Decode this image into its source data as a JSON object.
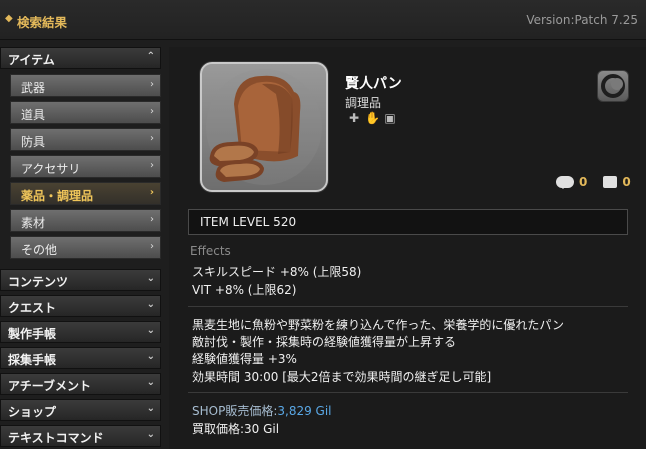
{
  "header": {
    "title": "検索結果",
    "version": "Version:Patch 7.25"
  },
  "sidebar": {
    "cat_item": "アイテム",
    "subs": [
      "武器",
      "道具",
      "防具",
      "アクセサリ",
      "薬品・調理品",
      "素材",
      "その他"
    ],
    "cats": [
      "コンテンツ",
      "クエスト",
      "製作手帳",
      "採集手帳",
      "アチーブメント",
      "ショップ",
      "テキストコマンド"
    ]
  },
  "item": {
    "name": "賢人パン",
    "type": "調理品",
    "comment_count": "0",
    "lodestone_count": "0",
    "item_level": "ITEM LEVEL 520"
  },
  "effects": {
    "label": "Effects",
    "lines": [
      "スキルスピード +8% (上限58)",
      "VIT +8% (上限62)"
    ]
  },
  "description": [
    "黒麦生地に魚粉や野菜粉を練り込んで作った、栄養学的に優れたパン",
    "敵討伐・製作・採集時の経験値獲得量が上昇する",
    "経験値獲得量 +3%",
    "効果時間 30:00 [最大2倍まで効果時間の継ぎ足し可能]"
  ],
  "prices": {
    "shop_label": "SHOP販売価格:",
    "shop_value": "3,829 Gil",
    "buy_label": "買取価格:30 Gil"
  }
}
